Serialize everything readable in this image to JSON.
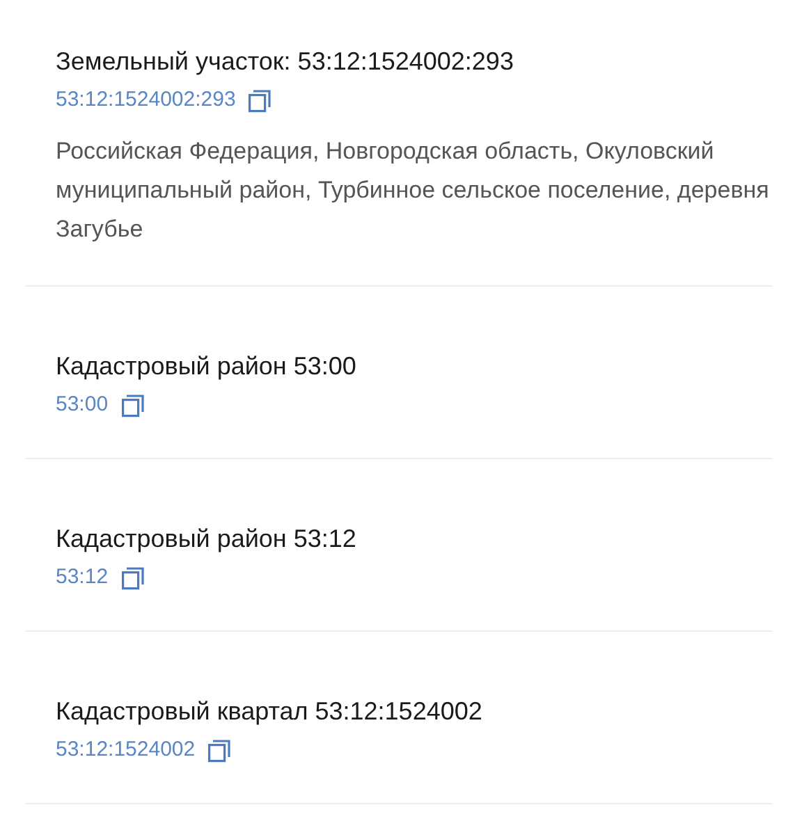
{
  "items": [
    {
      "title": "Земельный участок: 53:12:1524002:293",
      "code": "53:12:1524002:293",
      "address": "Российская Федерация, Новгородская область, Окуловский муниципальный район, Турбинное сельское поселение, деревня Загубье"
    },
    {
      "title": "Кадастровый район 53:00",
      "code": "53:00"
    },
    {
      "title": "Кадастровый район 53:12",
      "code": "53:12"
    },
    {
      "title": "Кадастровый квартал 53:12:1524002",
      "code": "53:12:1524002"
    }
  ]
}
